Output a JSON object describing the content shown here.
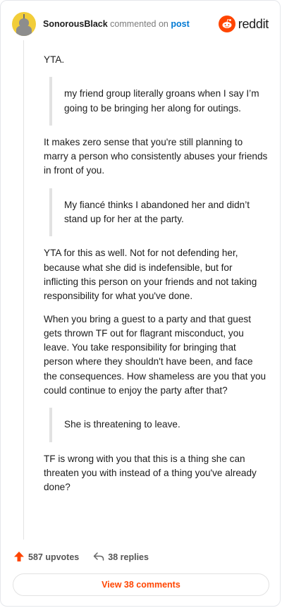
{
  "header": {
    "username": "SonorousBlack",
    "commented_on": "commented on",
    "post_link": "post",
    "brand": "reddit"
  },
  "comment": {
    "p1": "YTA.",
    "quote1": "my friend group literally groans when I say I’m going to be bringing her along for outings.",
    "p2": "It makes zero sense that you're still planning to marry a person who consistently abuses your friends in front of you.",
    "quote2": "My fiancé thinks I abandoned her and didn’t stand up for her at the party.",
    "p3": "YTA for this as well. Not for not defending her, because what she did is indefensible, but for inflicting this person on your friends and not taking responsibility for what you've done.",
    "p4": "When you bring a guest to a party and that guest gets thrown TF out for flagrant misconduct, you leave. You take responsibility for bringing that person where they shouldn't have been, and face the consequences. How shameless are you that you could continue to enjoy the party after that?",
    "quote3": "She is threatening to leave.",
    "p5": "TF is wrong with you that this is a thing she can threaten you with instead of a thing you've already done?"
  },
  "footer": {
    "upvotes": "587 upvotes",
    "replies": "38 replies",
    "view_comments": "View 38 comments"
  },
  "icons": {
    "upvote": "arrow-up-icon",
    "reply": "reply-arrow-icon",
    "brand": "snoo-icon"
  },
  "colors": {
    "accent": "#ff4500",
    "link": "#0079d3",
    "avatar_bg": "#f2cd39"
  }
}
